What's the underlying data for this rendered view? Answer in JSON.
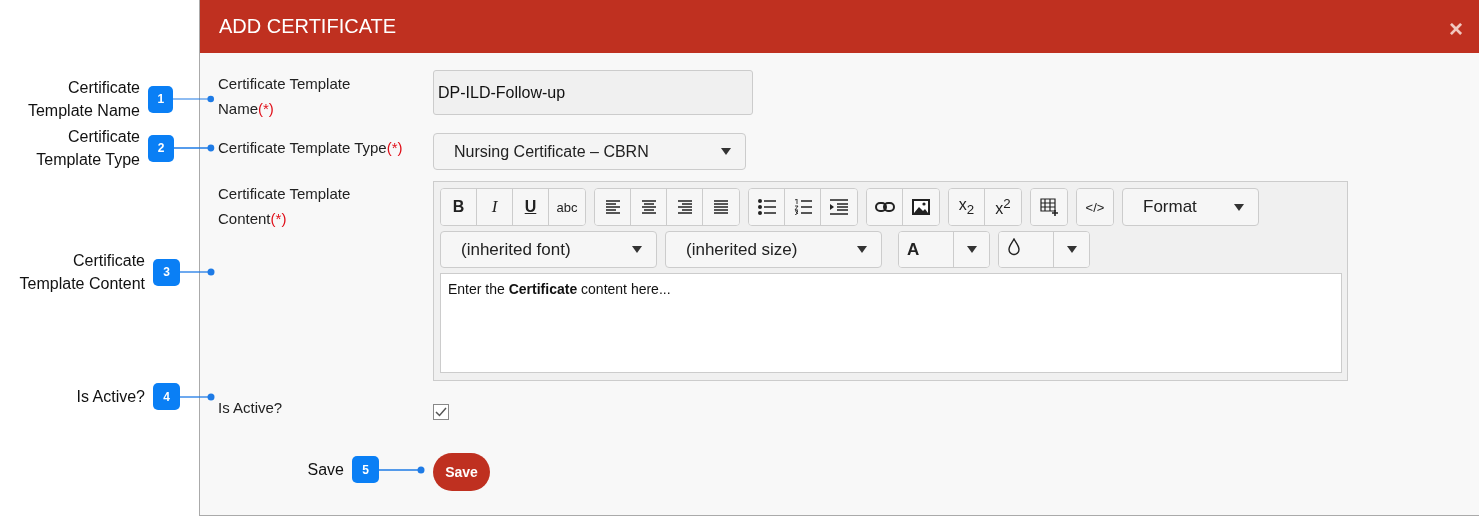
{
  "dialog": {
    "title": "ADD CERTIFICATE",
    "close": "×"
  },
  "fields": [
    {
      "kind": "text",
      "label": "Certificate Template Name",
      "required": "(*)",
      "value": "DP-ILD-Follow-up"
    },
    {
      "kind": "select",
      "label": "Certificate Template Type",
      "required": "(*)",
      "value": "Nursing Certificate – CBRN"
    },
    {
      "kind": "editor",
      "label": "Certificate Template Content",
      "required": "(*)",
      "content": "Enter the **Certificate** content here..."
    },
    {
      "kind": "checkbox",
      "label": "Is Active?",
      "checked": true
    }
  ],
  "toolbar": {
    "groups": [
      {
        "buttons": [
          {
            "kind": "bold",
            "label": "B"
          },
          {
            "kind": "italic",
            "label": "I"
          },
          {
            "kind": "underline",
            "label": "U"
          },
          {
            "kind": "strike",
            "label": "abc"
          }
        ]
      },
      {
        "buttons": [
          {
            "kind": "align-left"
          },
          {
            "kind": "align-center"
          },
          {
            "kind": "align-right"
          },
          {
            "kind": "justify"
          }
        ]
      },
      {
        "buttons": [
          {
            "kind": "bullets"
          },
          {
            "kind": "numbers"
          },
          {
            "kind": "indent"
          }
        ]
      },
      {
        "buttons": [
          {
            "kind": "link"
          },
          {
            "kind": "image"
          }
        ]
      },
      {
        "buttons": [
          {
            "kind": "script",
            "label": "x$_{2}$"
          },
          {
            "kind": "script",
            "label": "x$^{2}$"
          }
        ]
      },
      {
        "buttons": [
          {
            "kind": "table"
          }
        ]
      },
      {
        "buttons": [
          {
            "kind": "code",
            "label": "</>"
          }
        ]
      }
    ],
    "format": "Format",
    "font": "(inherited font)",
    "size": "(inherited size)",
    "font_color": "A"
  },
  "save_button": "Save",
  "callouts": [
    {
      "number": "1",
      "label": "Certificate Template Name"
    },
    {
      "number": "2",
      "label": "Certificate Template Type"
    },
    {
      "number": "3",
      "label": "Certificate Template Content"
    },
    {
      "number": "4",
      "label": "Is Active?"
    },
    {
      "number": "5",
      "label": "Save"
    }
  ]
}
